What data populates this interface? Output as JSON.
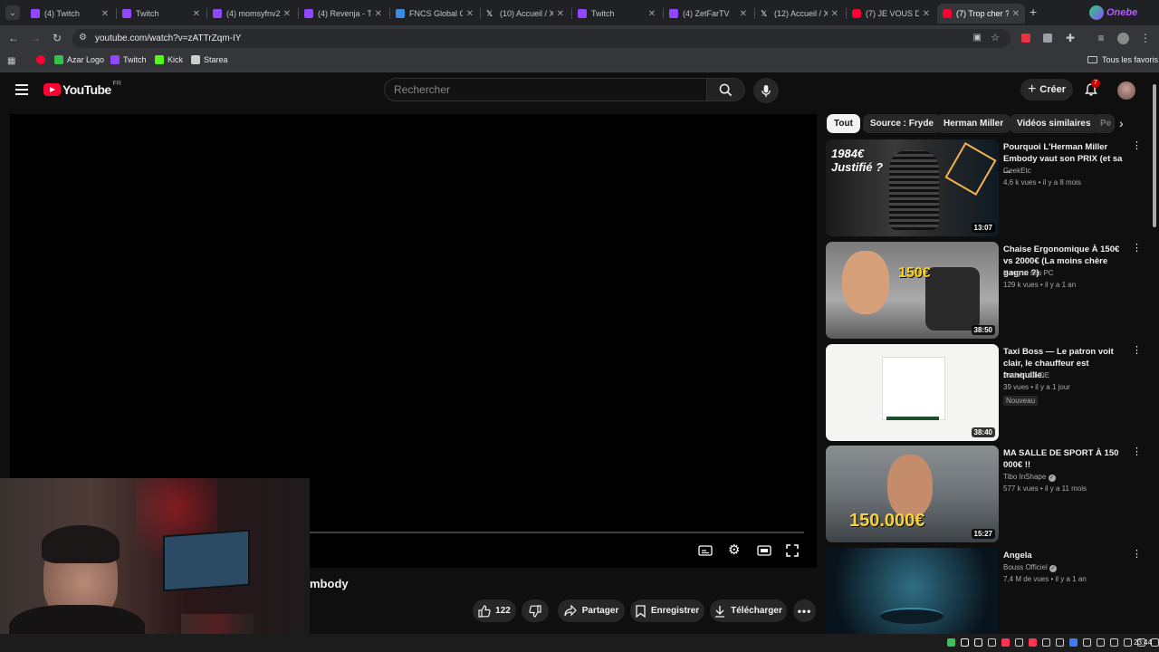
{
  "browser": {
    "tabs": [
      {
        "title": "(4) Twitch",
        "favicon": "twitch-icon",
        "color": "#9146ff"
      },
      {
        "title": "Twitch",
        "favicon": "twitch-icon",
        "color": "#9146ff"
      },
      {
        "title": "(4) momsyfnv2",
        "favicon": "twitch-icon",
        "color": "#9146ff"
      },
      {
        "title": "(4) Revenja - T",
        "favicon": "twitch-icon",
        "color": "#9146ff"
      },
      {
        "title": "FNCS Global C",
        "favicon": "fncs-icon",
        "color": "#3a8dde"
      },
      {
        "title": "(10) Accueil / X",
        "favicon": "x-icon",
        "color": "#ffffff"
      },
      {
        "title": "Twitch",
        "favicon": "twitch-icon",
        "color": "#9146ff"
      },
      {
        "title": "(4) ZetFarTV",
        "favicon": "twitch-icon",
        "color": "#9146ff"
      },
      {
        "title": "(12) Accueil / X",
        "favicon": "x-icon",
        "color": "#ffffff"
      },
      {
        "title": "(7) JE VOUS DE",
        "favicon": "youtube-icon",
        "color": "#ff0033"
      },
      {
        "title": "(7) Trop cher ?",
        "favicon": "youtube-icon",
        "color": "#ff0033",
        "active": true
      }
    ],
    "url": "youtube.com/watch?v=zATTrZqm-IY",
    "bookmarks": [
      {
        "label": "",
        "favicon": "youtube-icon",
        "color": "#ff0033"
      },
      {
        "label": "Azar Logo",
        "favicon": "azar-icon",
        "color": "#36c24a"
      },
      {
        "label": "Twitch",
        "favicon": "twitch-icon",
        "color": "#9146ff"
      },
      {
        "label": "Kick",
        "favicon": "kick-icon",
        "color": "#53fc18"
      },
      {
        "label": "Starea",
        "favicon": "starea-icon",
        "color": "#cccccc"
      }
    ],
    "all_bookmarks": "Tous les favoris",
    "profile_badge": "Onebe"
  },
  "youtube": {
    "logo_text": "YouTube",
    "region": "FR",
    "search_placeholder": "Rechercher",
    "create_label": "Créer",
    "notif_count": "7",
    "video_title_visible": "mbody",
    "likes": "122",
    "share_label": "Partager",
    "save_label": "Enregistrer",
    "download_label": "Télécharger",
    "chips": [
      "Tout",
      "Source : Fryde",
      "Herman Miller",
      "Vidéos similaires",
      "Pe"
    ],
    "recommendations": [
      {
        "title": "Pourquoi L'Herman Miller Embody vaut son PRIX (et sa ...",
        "channel": "GeekEtc",
        "meta": "4,6 k vues • il y a 8 mois",
        "duration": "13:07",
        "thumb_text": "1984€ Justifié ?",
        "verified": false
      },
      {
        "title": "Chaise Ergonomique À 150€ vs 2000€ (La moins chère gagne ?)",
        "channel": "Kang et ses PC",
        "meta": "129 k vues • il y a 1 an",
        "duration": "38:50",
        "thumb_text": "150€",
        "verified": false
      },
      {
        "title": "Taxi Boss — Le patron voit clair, le chauffeur est tranquille.",
        "channel": "André LONDE",
        "meta": "39 vues • il y a 1 jour",
        "badge": "Nouveau",
        "duration": "38:40",
        "thumb_text": "",
        "verified": false
      },
      {
        "title": "MA SALLE DE SPORT À 150 000€ !!",
        "channel": "Tibo InShape",
        "meta": "577 k vues • il y a 11 mois",
        "duration": "15:27",
        "thumb_text": "150.000€",
        "verified": true
      },
      {
        "title": "Angela",
        "channel": "Bouss Officiel",
        "meta": "7,4 M de vues • il y a 1 an",
        "duration": "",
        "thumb_text": "",
        "verified": true
      }
    ]
  },
  "taskbar": {
    "time": "23:44"
  }
}
